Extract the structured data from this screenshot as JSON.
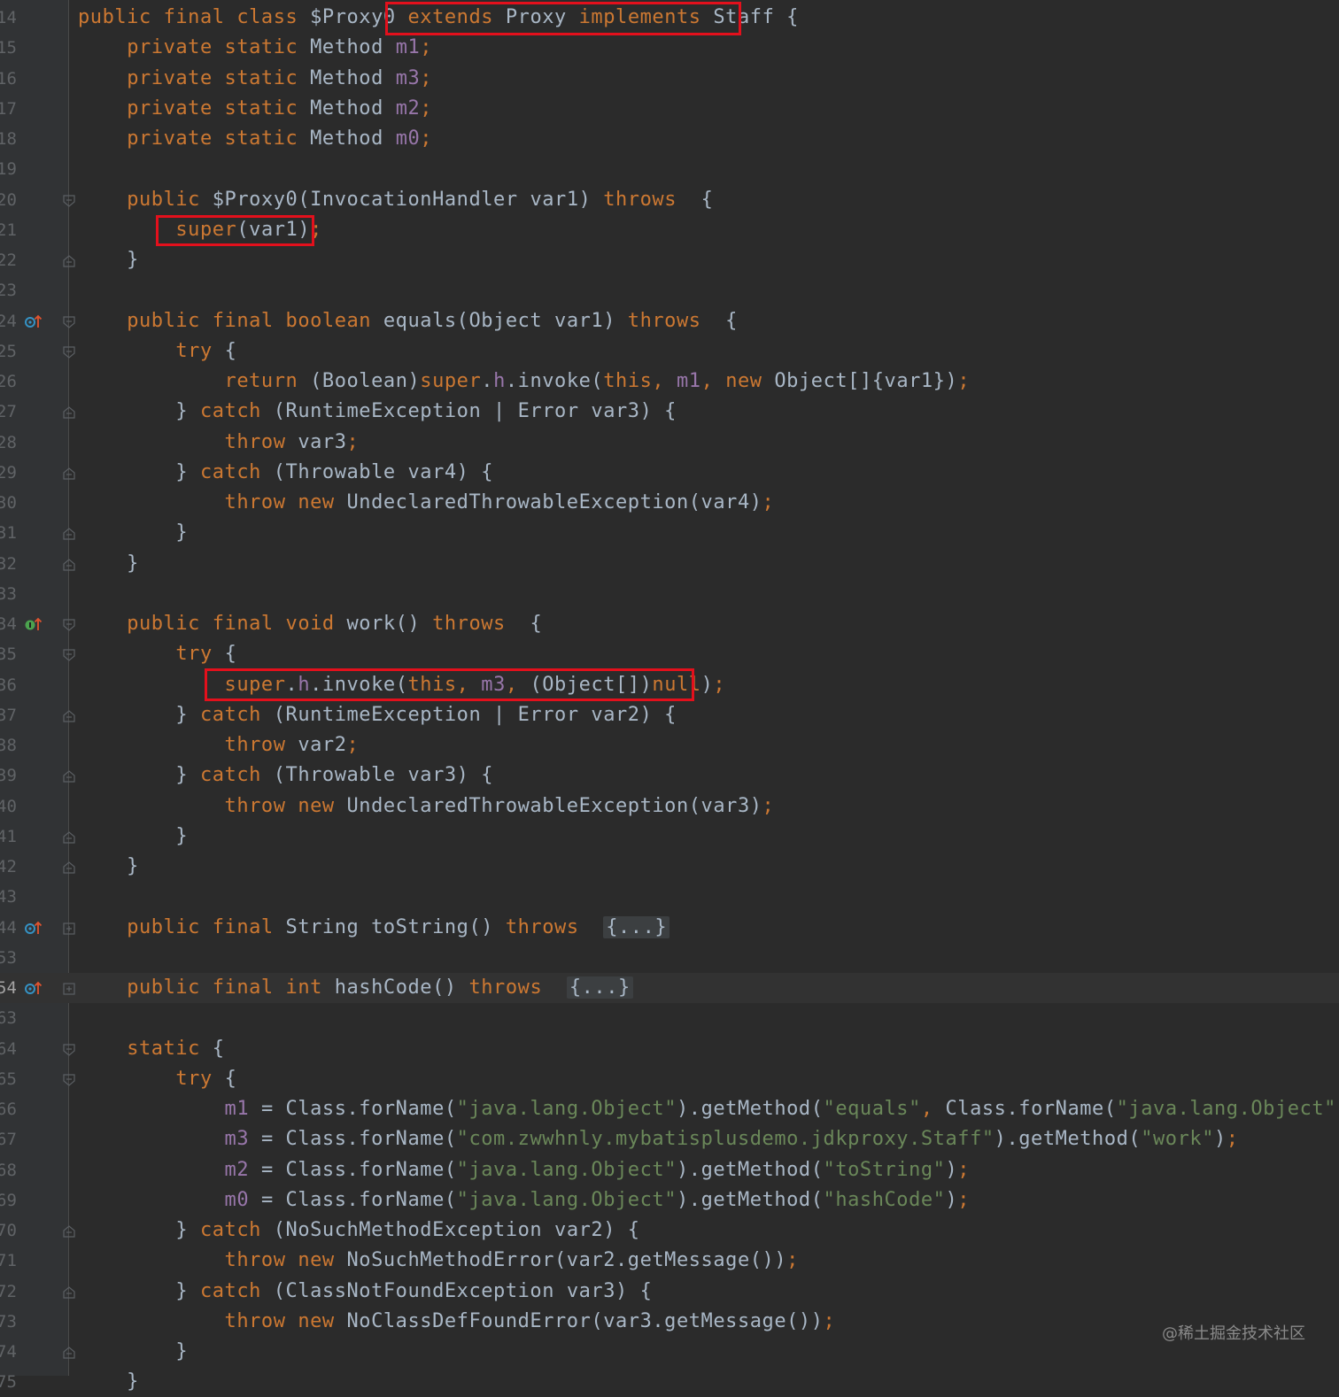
{
  "editor": {
    "lines": [
      {
        "n": "14",
        "tokens": [
          {
            "t": "public final class ",
            "c": "k"
          },
          {
            "t": "$Proxy0 "
          },
          {
            "t": "extends ",
            "c": "k"
          },
          {
            "t": "Proxy "
          },
          {
            "t": "implements ",
            "c": "k"
          },
          {
            "t": "Staff "
          },
          {
            "t": "{"
          }
        ]
      },
      {
        "n": "15",
        "tokens": [
          {
            "t": "    "
          },
          {
            "t": "private static ",
            "c": "k"
          },
          {
            "t": "Method "
          },
          {
            "t": "m1",
            "c": "p"
          },
          {
            "t": ";",
            "c": "k"
          }
        ]
      },
      {
        "n": "16",
        "tokens": [
          {
            "t": "    "
          },
          {
            "t": "private static ",
            "c": "k"
          },
          {
            "t": "Method "
          },
          {
            "t": "m3",
            "c": "p"
          },
          {
            "t": ";",
            "c": "k"
          }
        ]
      },
      {
        "n": "17",
        "tokens": [
          {
            "t": "    "
          },
          {
            "t": "private static ",
            "c": "k"
          },
          {
            "t": "Method "
          },
          {
            "t": "m2",
            "c": "p"
          },
          {
            "t": ";",
            "c": "k"
          }
        ]
      },
      {
        "n": "18",
        "tokens": [
          {
            "t": "    "
          },
          {
            "t": "private static ",
            "c": "k"
          },
          {
            "t": "Method "
          },
          {
            "t": "m0",
            "c": "p"
          },
          {
            "t": ";",
            "c": "k"
          }
        ]
      },
      {
        "n": "19",
        "tokens": []
      },
      {
        "n": "20",
        "fold": "open",
        "tokens": [
          {
            "t": "    "
          },
          {
            "t": "public ",
            "c": "k"
          },
          {
            "t": "$Proxy0(InvocationHandler var1) "
          },
          {
            "t": "throws ",
            "c": "k"
          },
          {
            "t": " {"
          }
        ]
      },
      {
        "n": "21",
        "tokens": [
          {
            "t": "        "
          },
          {
            "t": "super",
            "c": "k"
          },
          {
            "t": "(var1)"
          },
          {
            "t": ";",
            "c": "k"
          }
        ]
      },
      {
        "n": "22",
        "fold": "close",
        "tokens": [
          {
            "t": "    }"
          }
        ]
      },
      {
        "n": "23",
        "tokens": []
      },
      {
        "n": "24",
        "icon": "override",
        "fold": "open",
        "tokens": [
          {
            "t": "    "
          },
          {
            "t": "public final boolean ",
            "c": "k"
          },
          {
            "t": "equals(Object var1) "
          },
          {
            "t": "throws ",
            "c": "k"
          },
          {
            "t": " {"
          }
        ]
      },
      {
        "n": "25",
        "fold": "open",
        "tokens": [
          {
            "t": "        "
          },
          {
            "t": "try ",
            "c": "k"
          },
          {
            "t": "{"
          }
        ]
      },
      {
        "n": "26",
        "tokens": [
          {
            "t": "            "
          },
          {
            "t": "return ",
            "c": "k"
          },
          {
            "t": "(Boolean)"
          },
          {
            "t": "super",
            "c": "k"
          },
          {
            "t": "."
          },
          {
            "t": "h",
            "c": "p"
          },
          {
            "t": ".invoke("
          },
          {
            "t": "this, ",
            "c": "k"
          },
          {
            "t": "m1",
            "c": "p"
          },
          {
            "t": ", ",
            "c": "k"
          },
          {
            "t": "new ",
            "c": "k"
          },
          {
            "t": "Object[]{var1})"
          },
          {
            "t": ";",
            "c": "k"
          }
        ]
      },
      {
        "n": "27",
        "fold": "close",
        "tokens": [
          {
            "t": "        } "
          },
          {
            "t": "catch ",
            "c": "k"
          },
          {
            "t": "(RuntimeException | Error var3) {"
          }
        ]
      },
      {
        "n": "28",
        "tokens": [
          {
            "t": "            "
          },
          {
            "t": "throw ",
            "c": "k"
          },
          {
            "t": "var3"
          },
          {
            "t": ";",
            "c": "k"
          }
        ]
      },
      {
        "n": "29",
        "fold": "close",
        "tokens": [
          {
            "t": "        } "
          },
          {
            "t": "catch ",
            "c": "k"
          },
          {
            "t": "(Throwable var4) {"
          }
        ]
      },
      {
        "n": "30",
        "tokens": [
          {
            "t": "            "
          },
          {
            "t": "throw new ",
            "c": "k"
          },
          {
            "t": "UndeclaredThrowableException(var4)"
          },
          {
            "t": ";",
            "c": "k"
          }
        ]
      },
      {
        "n": "31",
        "fold": "close",
        "tokens": [
          {
            "t": "        }"
          }
        ]
      },
      {
        "n": "32",
        "fold": "close",
        "tokens": [
          {
            "t": "    }"
          }
        ]
      },
      {
        "n": "33",
        "tokens": []
      },
      {
        "n": "34",
        "icon": "implement",
        "fold": "open",
        "tokens": [
          {
            "t": "    "
          },
          {
            "t": "public final void ",
            "c": "k"
          },
          {
            "t": "work() "
          },
          {
            "t": "throws ",
            "c": "k"
          },
          {
            "t": " {"
          }
        ]
      },
      {
        "n": "35",
        "fold": "open",
        "tokens": [
          {
            "t": "        "
          },
          {
            "t": "try ",
            "c": "k"
          },
          {
            "t": "{"
          }
        ]
      },
      {
        "n": "36",
        "tokens": [
          {
            "t": "            "
          },
          {
            "t": "super",
            "c": "k"
          },
          {
            "t": "."
          },
          {
            "t": "h",
            "c": "p"
          },
          {
            "t": ".invoke("
          },
          {
            "t": "this, ",
            "c": "k"
          },
          {
            "t": "m3",
            "c": "p"
          },
          {
            "t": ", ",
            "c": "k"
          },
          {
            "t": "(Object[])"
          },
          {
            "t": "null",
            "c": "k"
          },
          {
            "t": ")"
          },
          {
            "t": ";",
            "c": "k"
          }
        ]
      },
      {
        "n": "37",
        "fold": "close",
        "tokens": [
          {
            "t": "        } "
          },
          {
            "t": "catch ",
            "c": "k"
          },
          {
            "t": "(RuntimeException | Error var2) {"
          }
        ]
      },
      {
        "n": "38",
        "tokens": [
          {
            "t": "            "
          },
          {
            "t": "throw ",
            "c": "k"
          },
          {
            "t": "var2"
          },
          {
            "t": ";",
            "c": "k"
          }
        ]
      },
      {
        "n": "39",
        "fold": "close",
        "tokens": [
          {
            "t": "        } "
          },
          {
            "t": "catch ",
            "c": "k"
          },
          {
            "t": "(Throwable var3) {"
          }
        ]
      },
      {
        "n": "40",
        "tokens": [
          {
            "t": "            "
          },
          {
            "t": "throw new ",
            "c": "k"
          },
          {
            "t": "UndeclaredThrowableException(var3)"
          },
          {
            "t": ";",
            "c": "k"
          }
        ]
      },
      {
        "n": "41",
        "fold": "close",
        "tokens": [
          {
            "t": "        }"
          }
        ]
      },
      {
        "n": "42",
        "fold": "close",
        "tokens": [
          {
            "t": "    }"
          }
        ]
      },
      {
        "n": "43",
        "tokens": []
      },
      {
        "n": "44",
        "icon": "override",
        "fold": "plus",
        "tokens": [
          {
            "t": "    "
          },
          {
            "t": "public final ",
            "c": "k"
          },
          {
            "t": "String toString() "
          },
          {
            "t": "throws ",
            "c": "k"
          },
          {
            "t": " "
          },
          {
            "t": "{...}",
            "c": "fl"
          }
        ]
      },
      {
        "n": "53",
        "tokens": []
      },
      {
        "n": "54",
        "icon": "override",
        "fold": "plus",
        "current": true,
        "tokens": [
          {
            "t": "    "
          },
          {
            "t": "public final int ",
            "c": "k"
          },
          {
            "t": "hashCode() "
          },
          {
            "t": "throws ",
            "c": "k"
          },
          {
            "t": " "
          },
          {
            "t": "{...}",
            "c": "fl"
          }
        ]
      },
      {
        "n": "63",
        "tokens": []
      },
      {
        "n": "64",
        "fold": "open",
        "tokens": [
          {
            "t": "    "
          },
          {
            "t": "static ",
            "c": "k"
          },
          {
            "t": "{"
          }
        ]
      },
      {
        "n": "65",
        "fold": "open",
        "tokens": [
          {
            "t": "        "
          },
          {
            "t": "try ",
            "c": "k"
          },
          {
            "t": "{"
          }
        ]
      },
      {
        "n": "66",
        "tokens": [
          {
            "t": "            "
          },
          {
            "t": "m1 ",
            "c": "p"
          },
          {
            "t": "= Class.forName("
          },
          {
            "t": "\"java.lang.Object\"",
            "c": "s"
          },
          {
            "t": ").getMethod("
          },
          {
            "t": "\"equals\"",
            "c": "s"
          },
          {
            "t": ", ",
            "c": "k"
          },
          {
            "t": "Class.forName("
          },
          {
            "t": "\"java.lang.Object\"",
            "c": "s"
          },
          {
            "t": "))"
          },
          {
            "t": ";",
            "c": "k"
          }
        ]
      },
      {
        "n": "67",
        "tokens": [
          {
            "t": "            "
          },
          {
            "t": "m3 ",
            "c": "p"
          },
          {
            "t": "= Class.forName("
          },
          {
            "t": "\"com.zwwhnly.mybatisplusdemo.jdkproxy.Staff\"",
            "c": "s"
          },
          {
            "t": ").getMethod("
          },
          {
            "t": "\"work\"",
            "c": "s"
          },
          {
            "t": ")"
          },
          {
            "t": ";",
            "c": "k"
          }
        ]
      },
      {
        "n": "68",
        "tokens": [
          {
            "t": "            "
          },
          {
            "t": "m2 ",
            "c": "p"
          },
          {
            "t": "= Class.forName("
          },
          {
            "t": "\"java.lang.Object\"",
            "c": "s"
          },
          {
            "t": ").getMethod("
          },
          {
            "t": "\"toString\"",
            "c": "s"
          },
          {
            "t": ")"
          },
          {
            "t": ";",
            "c": "k"
          }
        ]
      },
      {
        "n": "69",
        "tokens": [
          {
            "t": "            "
          },
          {
            "t": "m0 ",
            "c": "p"
          },
          {
            "t": "= Class.forName("
          },
          {
            "t": "\"java.lang.Object\"",
            "c": "s"
          },
          {
            "t": ").getMethod("
          },
          {
            "t": "\"hashCode\"",
            "c": "s"
          },
          {
            "t": ")"
          },
          {
            "t": ";",
            "c": "k"
          }
        ]
      },
      {
        "n": "70",
        "fold": "close",
        "tokens": [
          {
            "t": "        } "
          },
          {
            "t": "catch ",
            "c": "k"
          },
          {
            "t": "(NoSuchMethodException var2) {"
          }
        ]
      },
      {
        "n": "71",
        "tokens": [
          {
            "t": "            "
          },
          {
            "t": "throw new ",
            "c": "k"
          },
          {
            "t": "NoSuchMethodError(var2.getMessage())"
          },
          {
            "t": ";",
            "c": "k"
          }
        ]
      },
      {
        "n": "72",
        "fold": "close",
        "tokens": [
          {
            "t": "        } "
          },
          {
            "t": "catch ",
            "c": "k"
          },
          {
            "t": "(ClassNotFoundException var3) {"
          }
        ]
      },
      {
        "n": "73",
        "tokens": [
          {
            "t": "            "
          },
          {
            "t": "throw new ",
            "c": "k"
          },
          {
            "t": "NoClassDefFoundError(var3.getMessage())"
          },
          {
            "t": ";",
            "c": "k"
          }
        ]
      },
      {
        "n": "74",
        "fold": "close",
        "tokens": [
          {
            "t": "        }"
          }
        ]
      },
      {
        "n": "75",
        "tokens": [
          {
            "t": "    }"
          }
        ]
      }
    ]
  },
  "watermark": "@稀土掘金技术社区",
  "colors": {
    "background": "#2b2b2b",
    "gutter": "#313335",
    "keyword": "#cc7832",
    "string": "#6a8759",
    "field": "#9876aa",
    "plain": "#a9b7c6",
    "highlight_box": "#e3101c"
  }
}
